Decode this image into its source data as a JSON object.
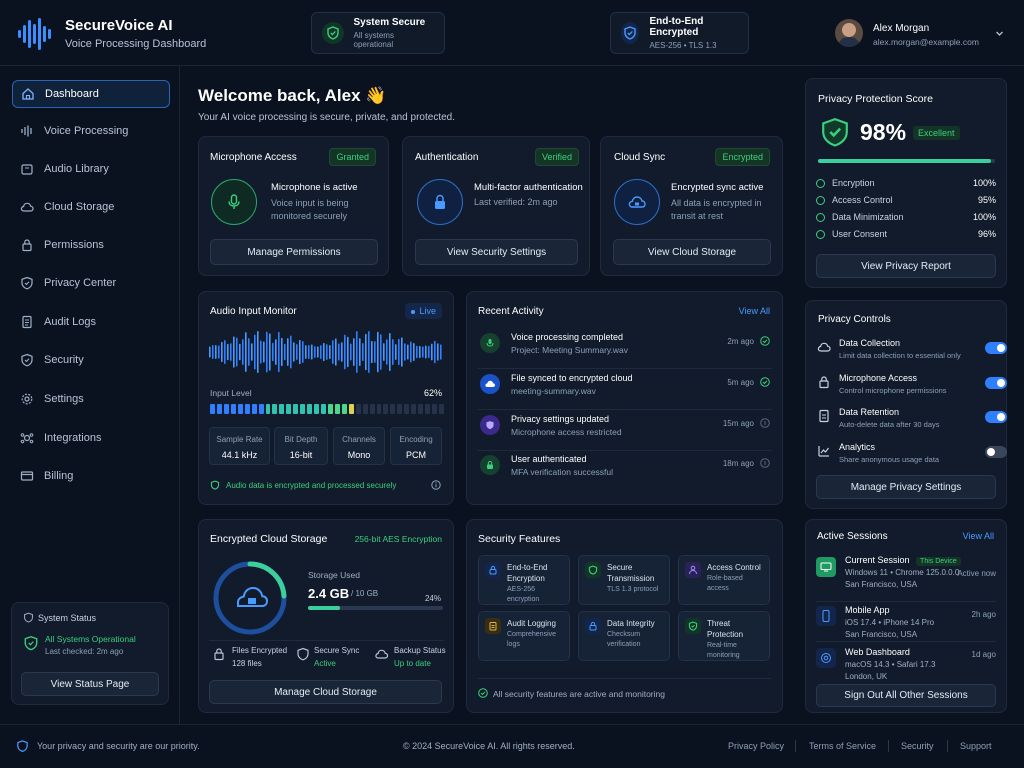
{
  "app": {
    "title": "SecureVoice AI",
    "subtitle": "Voice Processing Dashboard"
  },
  "status1": {
    "title": "System Secure",
    "sub": "All systems operational"
  },
  "status2": {
    "title": "End-to-End Encrypted",
    "sub": "AES-256 • TLS 1.3"
  },
  "user": {
    "name": "Alex Morgan",
    "email": "alex.morgan@example.com"
  },
  "nav": [
    "Dashboard",
    "Voice Processing",
    "Audio Library",
    "Cloud Storage",
    "Permissions",
    "Privacy Center",
    "Audit Logs",
    "Security",
    "Settings",
    "Integrations",
    "Billing"
  ],
  "system_status": {
    "title": "System Status",
    "status": "All Systems Operational",
    "checked": "Last checked: 2m ago",
    "button": "View Status Page"
  },
  "welcome": {
    "title": "Welcome back, Alex 👋",
    "sub": "Your AI voice processing is secure, private, and protected."
  },
  "cards": [
    {
      "title": "Microphone Access",
      "badge": "Granted",
      "h": "Microphone is active",
      "d": "Voice input is being monitored securely",
      "button": "Manage Permissions"
    },
    {
      "title": "Authentication",
      "badge": "Verified",
      "h": "Multi-factor authentication",
      "d": "Last verified: 2m ago",
      "button": "View Security Settings"
    },
    {
      "title": "Cloud Sync",
      "badge": "Encrypted",
      "h": "Encrypted sync active",
      "d": "All data is encrypted in transit at rest",
      "button": "View Cloud Storage"
    }
  ],
  "audio": {
    "title": "Audio Input Monitor",
    "live": "Live",
    "level_label": "Input Level",
    "level": "62%",
    "level_value": 0.62,
    "stats": [
      {
        "l": "Sample Rate",
        "v": "44.1 kHz"
      },
      {
        "l": "Bit Depth",
        "v": "16-bit"
      },
      {
        "l": "Channels",
        "v": "Mono"
      },
      {
        "l": "Encoding",
        "v": "PCM"
      }
    ],
    "note": "Audio data is encrypted and processed securely"
  },
  "activity": {
    "title": "Recent Activity",
    "view_all": "View All",
    "items": [
      {
        "t": "Voice processing completed",
        "d": "Project: Meeting Summary.wav",
        "time": "2m ago"
      },
      {
        "t": "File synced to encrypted cloud",
        "d": "meeting-summary.wav",
        "time": "5m ago"
      },
      {
        "t": "Privacy settings updated",
        "d": "Microphone access restricted",
        "time": "15m ago"
      },
      {
        "t": "User authenticated",
        "d": "MFA verification successful",
        "time": "18m ago"
      }
    ]
  },
  "storage": {
    "title": "Encrypted Cloud Storage",
    "badge": "256-bit AES Encryption",
    "used_label": "Storage Used",
    "used": "2.4 GB",
    "total": "/ 10 GB",
    "pct": "24%",
    "pct_value": 0.24,
    "files_label": "Files Encrypted",
    "files": "128 files",
    "sync_label": "Secure Sync",
    "sync": "Active",
    "backup_label": "Backup Status",
    "backup": "Up to date",
    "button": "Manage Cloud Storage"
  },
  "security": {
    "title": "Security Features",
    "items": [
      {
        "t": "End-to-End Encryption",
        "d": "AES-256 encryption"
      },
      {
        "t": "Secure Transmission",
        "d": "TLS 1.3 protocol"
      },
      {
        "t": "Access Control",
        "d": "Role-based access"
      },
      {
        "t": "Audit Logging",
        "d": "Comprehensive logs"
      },
      {
        "t": "Data Integrity",
        "d": "Checksum verification"
      },
      {
        "t": "Threat Protection",
        "d": "Real-time monitoring"
      }
    ],
    "note": "All security features are active and monitoring"
  },
  "privacy": {
    "title": "Privacy Protection Score",
    "score": "98%",
    "rating": "Excellent",
    "score_value": 0.98,
    "items": [
      {
        "k": "Encryption",
        "v": "100%"
      },
      {
        "k": "Access Control",
        "v": "95%"
      },
      {
        "k": "Data Minimization",
        "v": "100%"
      },
      {
        "k": "User Consent",
        "v": "96%"
      }
    ],
    "button": "View Privacy Report"
  },
  "controls": {
    "title": "Privacy Controls",
    "items": [
      {
        "n": "Data Collection",
        "d": "Limit data collection to essential only",
        "on": true
      },
      {
        "n": "Microphone Access",
        "d": "Control microphone permissions",
        "on": true
      },
      {
        "n": "Data Retention",
        "d": "Auto-delete data after 30 days",
        "on": true
      },
      {
        "n": "Analytics",
        "d": "Share anonymous usage data",
        "on": false
      }
    ],
    "button": "Manage Privacy Settings"
  },
  "sessions": {
    "title": "Active Sessions",
    "view_all": "View All",
    "items": [
      {
        "n": "Current Session",
        "tag": "This Device",
        "d1": "Windows 11 • Chrome 125.0.0.0",
        "d2": "San Francisco, USA",
        "s": "Active now"
      },
      {
        "n": "Mobile App",
        "d1": "iOS 17.4 • iPhone 14 Pro",
        "d2": "San Francisco, USA",
        "s": "2h ago"
      },
      {
        "n": "Web Dashboard",
        "d1": "macOS 14.3 • Safari 17.3",
        "d2": "London, UK",
        "s": "1d ago"
      }
    ],
    "button": "Sign Out All Other Sessions"
  },
  "footer": {
    "left": "Your privacy and security are our priority.",
    "center": "© 2024 SecureVoice AI. All rights reserved.",
    "links": [
      "Privacy Policy",
      "Terms of Service",
      "Security",
      "Support"
    ]
  },
  "colors": {
    "accent": "#2f7fff",
    "success": "#3ccf7e",
    "bg": "#0a1220",
    "card": "#111b2b"
  }
}
